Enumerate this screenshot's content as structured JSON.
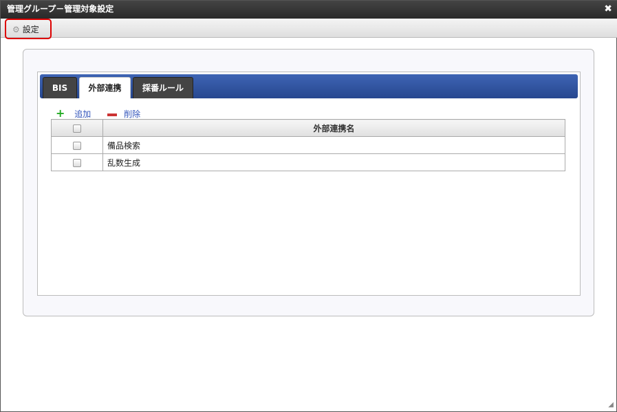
{
  "window": {
    "title": "管理グループ－管理対象設定",
    "close_icon": "✖"
  },
  "toolbar": {
    "settings_label": "設定"
  },
  "tabs": [
    {
      "label": "BIS"
    },
    {
      "label": "外部連携"
    },
    {
      "label": "採番ルール"
    }
  ],
  "actions": {
    "add": "追加",
    "delete": "削除"
  },
  "table": {
    "header": "外部連携名",
    "rows": [
      {
        "name": "備品検索"
      },
      {
        "name": "乱数生成"
      }
    ]
  }
}
